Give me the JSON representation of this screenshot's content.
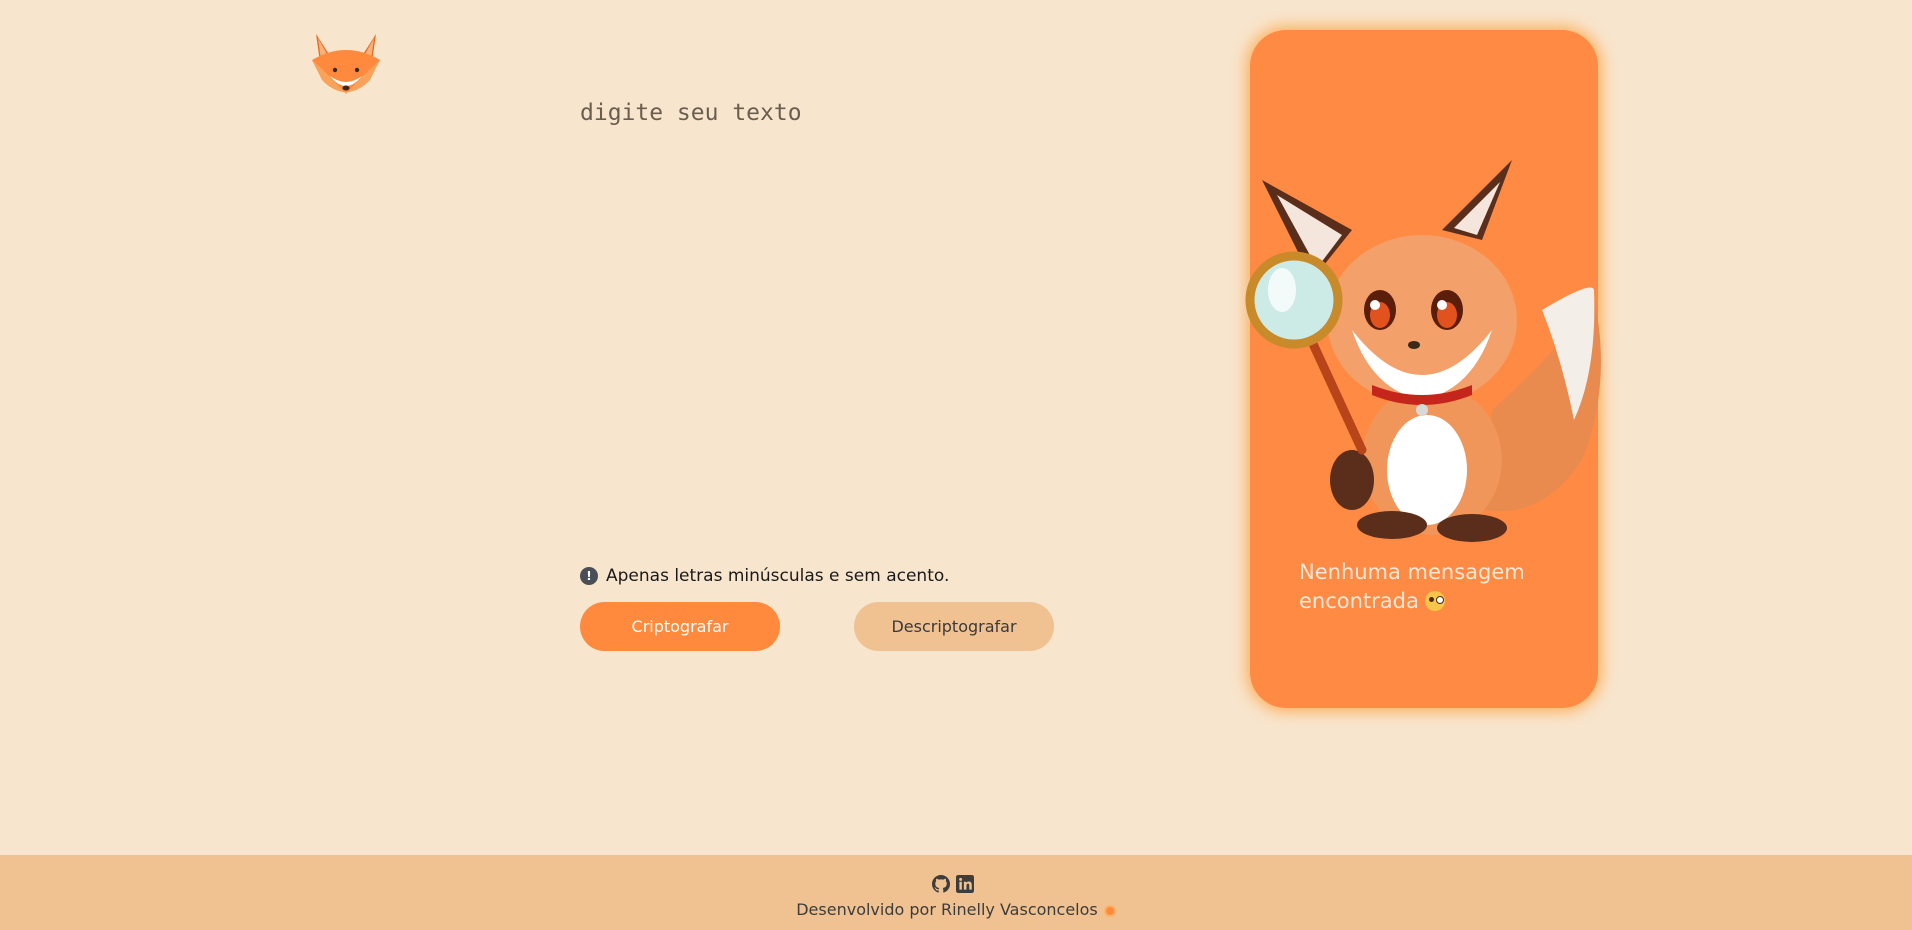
{
  "logo": {
    "icon": "fox-logo-icon"
  },
  "editor": {
    "placeholder": "digite seu texto",
    "value": ""
  },
  "hint": {
    "icon": "exclamation-circle-icon",
    "text": "Apenas letras minúsculas e sem acento."
  },
  "actions": {
    "encrypt_label": "Criptografar",
    "decrypt_label": "Descriptografar"
  },
  "result_panel": {
    "illustration": "fox-with-magnifying-glass",
    "message": "Nenhuma mensagem encontrada",
    "message_emoji": "face-with-monocle-emoji"
  },
  "footer": {
    "icons": [
      "github-icon",
      "linkedin-icon"
    ],
    "credit": "Desenvolvido por Rinelly Vasconcelos",
    "credit_icon": "sun-icon"
  },
  "colors": {
    "background": "#f8e5cd",
    "accent": "#ff8a3d",
    "secondary": "#f0c191",
    "panel": "#ff8a43"
  }
}
